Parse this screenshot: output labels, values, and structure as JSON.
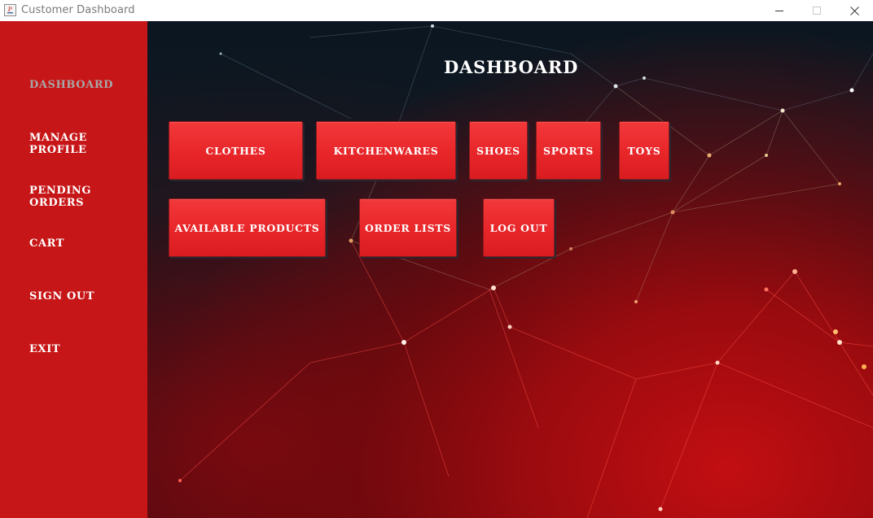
{
  "window": {
    "title": "Customer Dashboard",
    "icons": [
      "java-app-icon",
      "minimize-icon",
      "maximize-icon",
      "close-icon"
    ]
  },
  "sidebar": {
    "items": [
      {
        "label": "DASHBOARD",
        "active": true
      },
      {
        "label": "MANAGE PROFILE",
        "active": false
      },
      {
        "label": "PENDING ORDERS",
        "active": false
      },
      {
        "label": "CART",
        "active": false
      },
      {
        "label": "SIGN OUT",
        "active": false
      },
      {
        "label": "EXIT",
        "active": false
      }
    ]
  },
  "main": {
    "title": "DASHBOARD",
    "tiles": [
      {
        "label": "CLOTHES"
      },
      {
        "label": "KITCHENWARES"
      },
      {
        "label": "SHOES"
      },
      {
        "label": "SPORTS"
      },
      {
        "label": "TOYS"
      },
      {
        "label": "AVAILABLE PRODUCTS"
      },
      {
        "label": "ORDER LISTS"
      },
      {
        "label": "LOG OUT"
      }
    ]
  },
  "colors": {
    "sidebar": "#c71617",
    "tile": "#e8262a",
    "active_nav": "#a8a8a8",
    "text": "#ffffff"
  }
}
